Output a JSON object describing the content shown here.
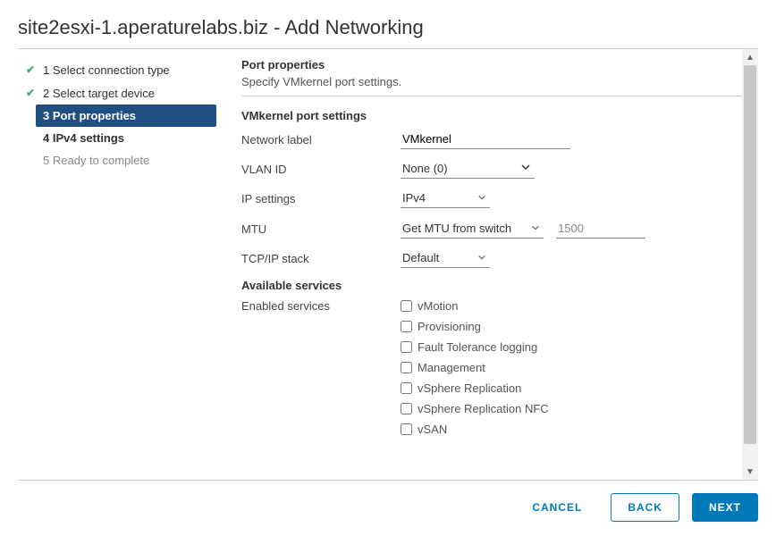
{
  "title": "site2esxi-1.aperaturelabs.biz - Add Networking",
  "steps": [
    {
      "label": "1 Select connection type",
      "state": "done"
    },
    {
      "label": "2 Select target device",
      "state": "done"
    },
    {
      "label": "3 Port properties",
      "state": "current"
    },
    {
      "label": "4 IPv4 settings",
      "state": "upcoming"
    },
    {
      "label": "5 Ready to complete",
      "state": "future"
    }
  ],
  "section": {
    "title": "Port properties",
    "subtitle": "Specify VMkernel port settings."
  },
  "settings_header": "VMkernel port settings",
  "fields": {
    "network_label": {
      "label": "Network label",
      "value": "VMkernel"
    },
    "vlan_id": {
      "label": "VLAN ID",
      "value": "None (0)"
    },
    "ip_settings": {
      "label": "IP settings",
      "value": "IPv4"
    },
    "mtu": {
      "label": "MTU",
      "mode": "Get MTU from switch",
      "value": "1500"
    },
    "tcpip_stack": {
      "label": "TCP/IP stack",
      "value": "Default"
    }
  },
  "services_header": "Available services",
  "enabled_services_label": "Enabled services",
  "services": [
    {
      "label": "vMotion",
      "checked": false
    },
    {
      "label": "Provisioning",
      "checked": false
    },
    {
      "label": "Fault Tolerance logging",
      "checked": false
    },
    {
      "label": "Management",
      "checked": false
    },
    {
      "label": "vSphere Replication",
      "checked": false
    },
    {
      "label": "vSphere Replication NFC",
      "checked": false
    },
    {
      "label": "vSAN",
      "checked": false
    }
  ],
  "buttons": {
    "cancel": "CANCEL",
    "back": "BACK",
    "next": "NEXT"
  }
}
